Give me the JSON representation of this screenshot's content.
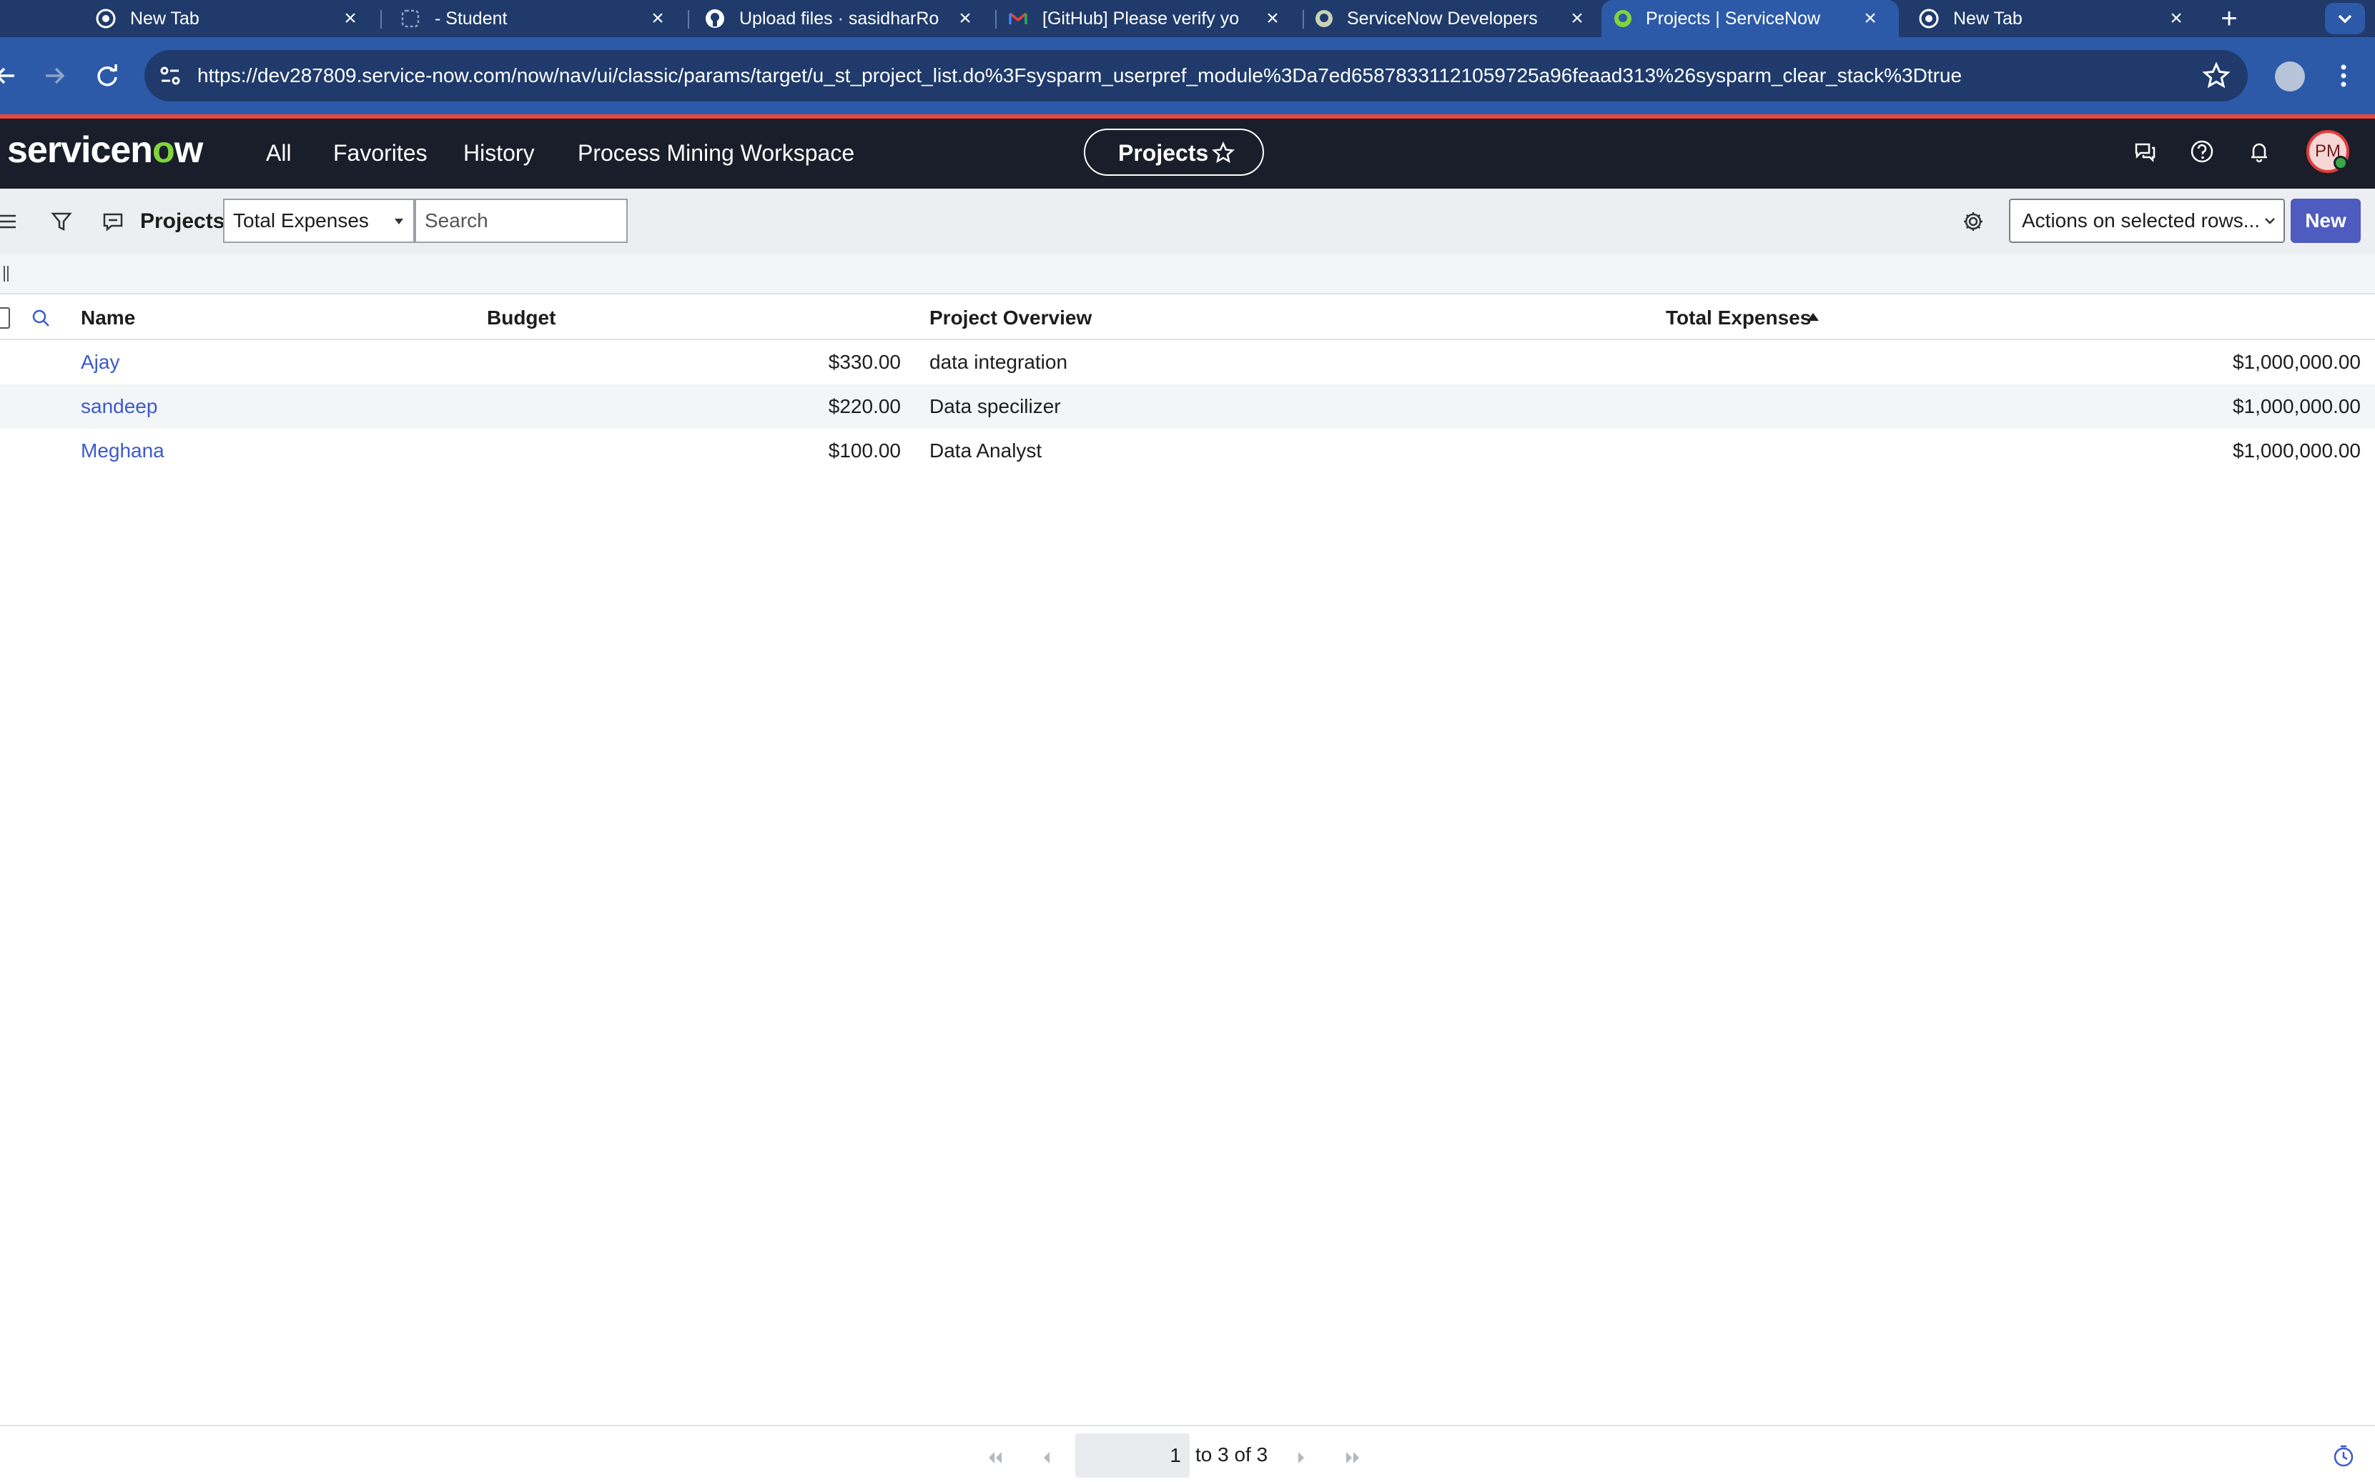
{
  "browser": {
    "tabs": [
      {
        "title": "New Tab",
        "icon": "chrome-icon"
      },
      {
        "title": "- Student",
        "icon": "page-icon"
      },
      {
        "title": "Upload files · sasidharRo",
        "icon": "github-icon"
      },
      {
        "title": "[GitHub] Please verify yo",
        "icon": "gmail-icon"
      },
      {
        "title": "ServiceNow Developers",
        "icon": "servicenow-icon"
      },
      {
        "title": "Projects | ServiceNow",
        "icon": "servicenow-icon",
        "active": true
      },
      {
        "title": "New Tab",
        "icon": "chrome-icon"
      }
    ],
    "new_tab_label": "+",
    "url": "https://dev287809.service-now.com/now/nav/ui/classic/params/target/u_st_project_list.do%3Fsysparm_userpref_module%3Da7ed65878331121059725a96feaad313%26sysparm_clear_stack%3Dtrue"
  },
  "header": {
    "logo": {
      "pre": "servicen",
      "o": "o",
      "post": "w"
    },
    "menu": [
      "All",
      "Favorites",
      "History",
      "Process Mining Workspace"
    ],
    "context_title": "Projects",
    "avatar_initials": "PM"
  },
  "list": {
    "title": "Projects",
    "field_select_value": "Total Expenses",
    "search_placeholder": "Search",
    "actions_select_value": "Actions on selected rows...",
    "new_label": "New",
    "columns": [
      "Name",
      "Budget",
      "Project Overview",
      "Total Expenses"
    ],
    "sorted_column": "Total Expenses",
    "sort_direction": "ascending",
    "rows": [
      {
        "name": "Ajay",
        "budget": "$330.00",
        "overview": "data integration",
        "total": "$1,000,000.00"
      },
      {
        "name": "sandeep",
        "budget": "$220.00",
        "overview": "Data specilizer",
        "total": "$1,000,000.00"
      },
      {
        "name": "Meghana",
        "budget": "$100.00",
        "overview": "Data Analyst",
        "total": "$1,000,000.00"
      }
    ]
  },
  "pagination": {
    "current_page": "1",
    "range_text": "to 3 of 3"
  },
  "colors": {
    "tab_strip": "#1f3a6b",
    "toolbar": "#2c5aa8",
    "accent_line": "#e8473b",
    "sn_header": "#1a1e2a",
    "new_button": "#4e5bbf",
    "link": "#3b5bcc"
  }
}
